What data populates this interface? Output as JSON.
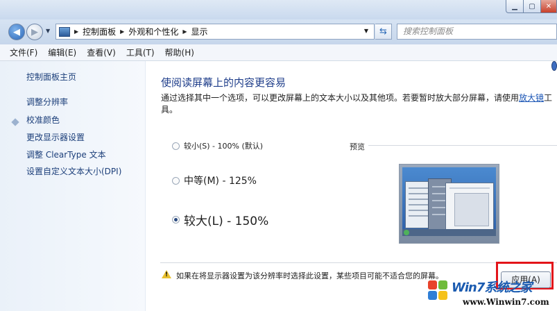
{
  "window": {
    "title": "",
    "min_label": "▁",
    "max_label": "▢",
    "close_label": "✕"
  },
  "nav": {
    "back_icon": "arrow-left",
    "forward_icon": "arrow-right"
  },
  "address": {
    "breadcrumbs": [
      "控制面板",
      "外观和个性化",
      "显示"
    ],
    "search_placeholder": "搜索控制面板"
  },
  "menu": [
    "文件(F)",
    "编辑(E)",
    "查看(V)",
    "工具(T)",
    "帮助(H)"
  ],
  "sidebar": {
    "home": "控制面板主页",
    "links": [
      "调整分辨率",
      "校准颜色",
      "更改显示器设置",
      "调整 ClearType 文本",
      "设置自定义文本大小(DPI)"
    ]
  },
  "main": {
    "heading": "使阅读屏幕上的内容更容易",
    "desc_before": "通过选择其中一个选项，可以更改屏幕上的文本大小以及其他项。若要暂时放大部分屏幕，请使用",
    "desc_link": "放大镜",
    "desc_after": "工具。",
    "options": [
      {
        "label": "较小(S) - 100% (默认)",
        "selected": false
      },
      {
        "label": "中等(M) - 125%",
        "selected": false
      },
      {
        "label": "较大(L) - 150%",
        "selected": true
      }
    ],
    "preview_label": "预览",
    "warning": "如果在将显示器设置为该分辨率时选择此设置，某些项目可能不适合您的屏幕。",
    "apply_label": "应用(A)"
  },
  "watermark": {
    "brand": "Win7系统之家",
    "url": "www.Winwin7.com"
  },
  "colors": {
    "link": "#1c3f7a",
    "heading": "#1e3d8a",
    "highlight": "#e3141a"
  }
}
